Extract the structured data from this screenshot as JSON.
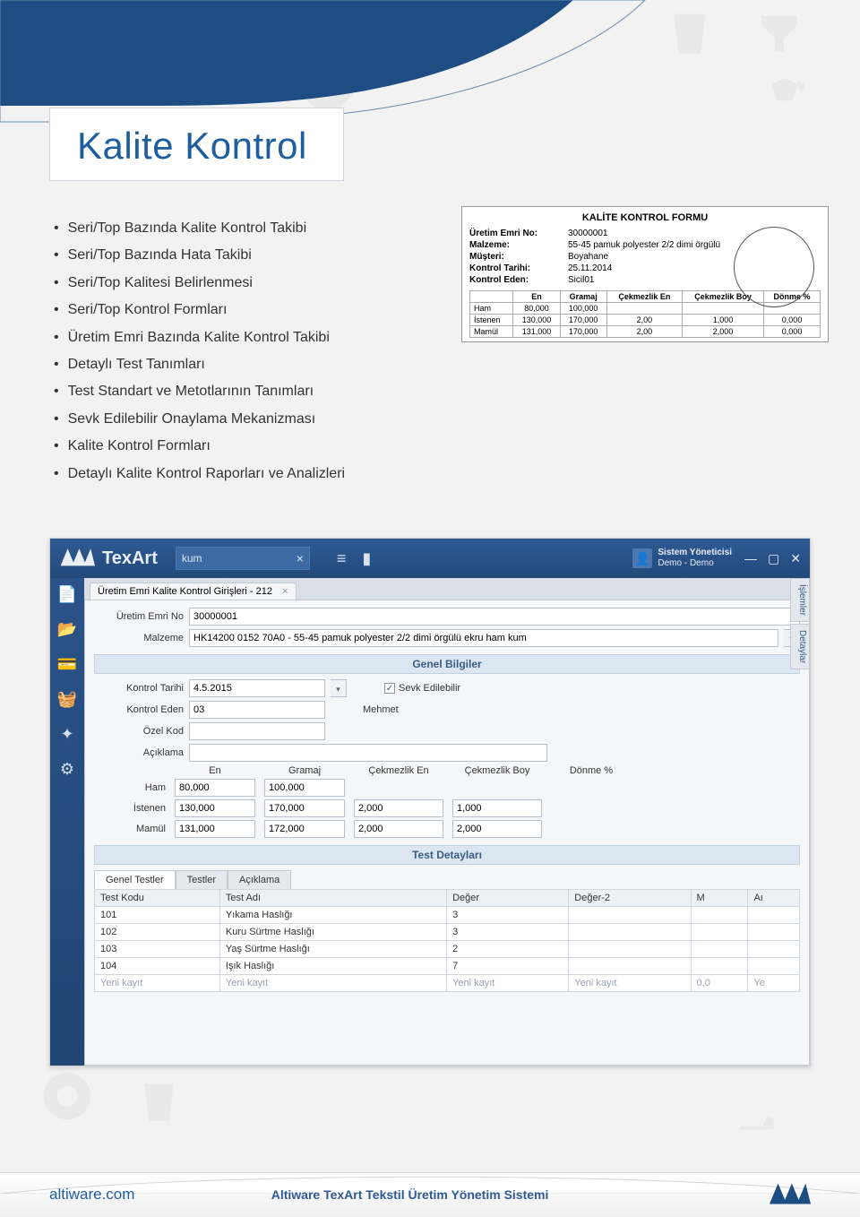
{
  "page": {
    "title": "Kalite Kontrol",
    "bullets": [
      "Seri/Top Bazında Kalite Kontrol Takibi",
      "Seri/Top Bazında Hata Takibi",
      "Seri/Top Kalitesi Belirlenmesi",
      "Seri/Top Kontrol Formları",
      "Üretim Emri Bazında Kalite Kontrol Takibi",
      "Detaylı Test Tanımları",
      "Test Standart ve Metotlarının Tanımları",
      "Sevk Edilebilir  Onaylama Mekanizması",
      "Kalite Kontrol Formları",
      "Detaylı Kalite Kontrol Raporları ve Analizleri"
    ]
  },
  "form": {
    "title": "KALİTE KONTROL FORMU",
    "rows": {
      "uretim_emri_no_label": "Üretim Emri No:",
      "uretim_emri_no": "30000001",
      "malzeme_label": "Malzeme:",
      "malzeme": "55-45 pamuk polyester 2/2 dimi örgülü",
      "musteri_label": "Müşteri:",
      "musteri": "Boyahane",
      "kontrol_tarihi_label": "Kontrol Tarihi:",
      "kontrol_tarihi": "25.11.2014",
      "kontrol_eden_label": "Kontrol Eden:",
      "kontrol_eden": "Sicil01"
    },
    "table": {
      "headers": [
        "",
        "En",
        "Gramaj",
        "Çekmezlik En",
        "Çekmezlik Boy",
        "Dönme %"
      ],
      "rows": [
        {
          "label": "Ham",
          "cells": [
            "80,000",
            "100,000",
            "",
            "",
            ""
          ]
        },
        {
          "label": "İstenen",
          "cells": [
            "130,000",
            "170,000",
            "2,00",
            "1,000",
            "0,000"
          ]
        },
        {
          "label": "Mamül",
          "cells": [
            "131,000",
            "170,000",
            "2,00",
            "2,000",
            "0,000"
          ]
        }
      ]
    }
  },
  "app": {
    "brand": "TexArt",
    "search_value": "kum",
    "user": {
      "line1": "Sistem Yöneticisi",
      "line2": "Demo - Demo"
    },
    "sidebar_icons": [
      "new-doc-icon",
      "docs-icon",
      "card-icon",
      "basket-icon",
      "star-icon",
      "gear-icon"
    ],
    "tab": {
      "label": "Üretim Emri Kalite Kontrol Girişleri - 212"
    },
    "right_tabs": [
      "İşlemler",
      "Detaylar"
    ],
    "fields": {
      "uretim_emri_no_label": "Üretim Emri No",
      "uretim_emri_no": "30000001",
      "malzeme_label": "Malzeme",
      "malzeme": "HK14200 0152 70A0 - 55-45 pamuk polyester 2/2 dimi örgülü ekru ham kum",
      "genel_bilgiler": "Genel Bilgiler",
      "kontrol_tarihi_label": "Kontrol Tarihi",
      "kontrol_tarihi": "4.5.2015",
      "sevk_edilebilir": "Sevk Edilebilir",
      "kontrol_eden_label": "Kontrol Eden",
      "kontrol_eden": "03",
      "kontrol_eden_ad": "Mehmet",
      "ozel_kod_label": "Özel Kod",
      "ozel_kod": "",
      "aciklama_label": "Açıklama",
      "aciklama": ""
    },
    "grid": {
      "headers": [
        "",
        "En",
        "Gramaj",
        "Çekmezlik En",
        "Çekmezlik Boy",
        "Dönme %"
      ],
      "rows": [
        {
          "label": "Ham",
          "cells": [
            "80,000",
            "100,000",
            "",
            "",
            ""
          ]
        },
        {
          "label": "İstenen",
          "cells": [
            "130,000",
            "170,000",
            "2,000",
            "1,000",
            ""
          ]
        },
        {
          "label": "Mamül",
          "cells": [
            "131,000",
            "172,000",
            "2,000",
            "2,000",
            ""
          ]
        }
      ]
    },
    "test_detaylari": "Test Detayları",
    "tabs2": [
      "Genel Testler",
      "Testler",
      "Açıklama"
    ],
    "dgrid": {
      "headers": [
        "Test Kodu",
        "Test Adı",
        "Değer",
        "Değer-2",
        "M",
        "Aı"
      ],
      "rows": [
        [
          "101",
          "Yıkama Haslığı",
          "3",
          "",
          "",
          ""
        ],
        [
          "102",
          "Kuru Sürtme Haslığı",
          "3",
          "",
          "",
          ""
        ],
        [
          "103",
          "Yaş Sürtme Haslığı",
          "2",
          "",
          "",
          ""
        ],
        [
          "104",
          "Işık Haslığı",
          "7",
          "",
          "",
          ""
        ],
        [
          "Yeni kayıt",
          "Yeni kayıt",
          "Yeni kayıt",
          "Yeni kayıt",
          "0,0",
          "Ye"
        ]
      ]
    }
  },
  "footer": {
    "site": "altiware.com",
    "product": "Altiware TexArt Tekstil Üretim Yönetim Sistemi"
  }
}
